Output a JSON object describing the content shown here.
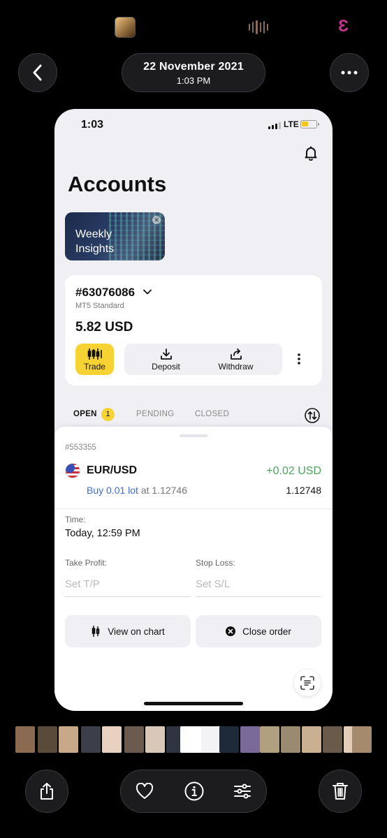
{
  "viewer": {
    "date": "22 November 2021",
    "time": "1:03 PM",
    "colors": {
      "background": "#000000",
      "button_bg": "#1c1c1e",
      "e_icon": "#c2348d"
    },
    "icons": [
      "app-thumbnail-icon",
      "voice-icon",
      "e-app-icon",
      "back-chevron-icon",
      "more-dots-icon"
    ]
  },
  "phone": {
    "status": {
      "time": "1:03",
      "network": "LTE",
      "battery_level": 0.45
    },
    "page_title": "Accounts",
    "insights": {
      "label_line1": "Weekly",
      "label_line2": "Insights"
    },
    "account": {
      "number": "#63076086",
      "type": "MT5 Standard",
      "balance": "5.82 USD",
      "actions": {
        "trade": "Trade",
        "deposit": "Deposit",
        "withdraw": "Withdraw"
      }
    },
    "tabs": {
      "open": "OPEN",
      "open_count": "1",
      "pending": "PENDING",
      "closed": "CLOSED"
    },
    "order": {
      "id": "#553355",
      "pair": "EUR/USD",
      "pnl": "+0.02 USD",
      "direction_lot": "Buy 0.01 lot",
      "at_price": " at 1.12746",
      "current_price": "1.12748",
      "time_label": "Time:",
      "time_value": "Today, 12:59 PM",
      "take_profit_label": "Take Profit:",
      "take_profit_placeholder": "Set T/P",
      "stop_loss_label": "Stop Loss:",
      "stop_loss_placeholder": "Set S/L",
      "view_chart": "View on chart",
      "close_order": "Close order"
    },
    "colors": {
      "accent_yellow": "#f6d233",
      "profit_green": "#4aa55a",
      "link_blue": "#3b6bd1"
    }
  },
  "thumbnails": {
    "colors": [
      "#8a6b52",
      "#5a4a3a",
      "#c9a88a",
      "#3c3f4a",
      "#e7d2c2",
      "#6b5b4f",
      "#d9c8b8",
      "#2f3440",
      "#ffffff",
      "#f3f3f6",
      "#1e2a3a",
      "#7a6a9a",
      "#b0a080",
      "#9a8a70",
      "#c8b090",
      "#6a5a4a",
      "#e2cdb8",
      "#a58a6e"
    ]
  },
  "toolbar": {
    "icons": [
      "share-icon",
      "heart-icon",
      "info-icon",
      "adjust-icon",
      "trash-icon"
    ]
  }
}
